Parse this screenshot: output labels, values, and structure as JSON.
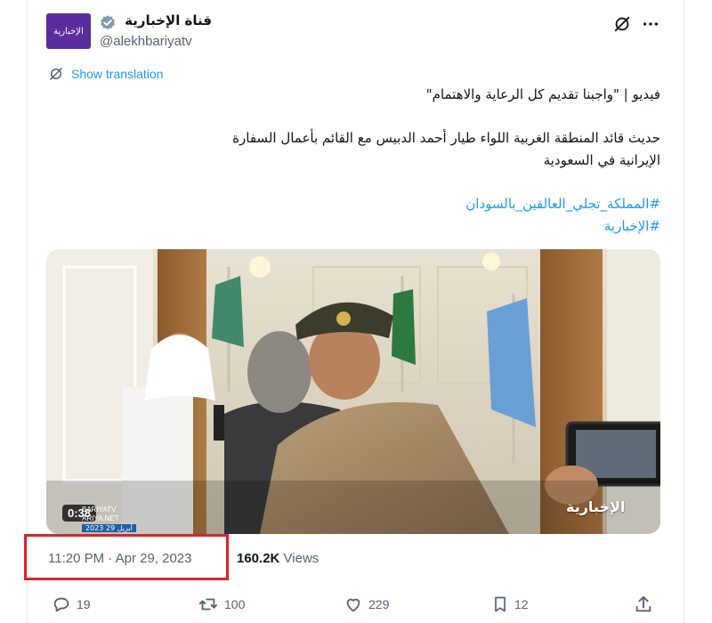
{
  "account": {
    "display_name": "قناة الإخبارية",
    "handle": "@alekhbariyatv",
    "avatar_text": "الإخبارية"
  },
  "translation": {
    "label": "Show translation"
  },
  "tweet": {
    "line1": "فيديو | \"واجبنا تقديم كل الرعاية والاهتمام\"",
    "line2": "حديث قائد المنطقة الغربية اللواء طيار أحمد الدبيس مع القائم بأعمال السفارة",
    "line3": "الإيرانية في السعودية",
    "hashtag1": "#المملكة_تجلي_العالقين_بالسودان",
    "hashtag2": "#الإخبارية"
  },
  "media": {
    "duration": "0:38",
    "watermark": "الإخبارية",
    "watermark_small_1": "BARIYATV",
    "watermark_small_2": "ARIYA.NET",
    "watermark_date": "2023 أبريل 29"
  },
  "meta": {
    "timestamp": "11:20 PM · Apr 29, 2023",
    "views_count": "160.2K",
    "views_label": "Views"
  },
  "actions": {
    "replies": "19",
    "reposts": "100",
    "likes": "229",
    "bookmarks": "12"
  },
  "colors": {
    "accent": "#1d9bf0",
    "highlight_box": "#e5202a",
    "secondary_text": "#536471"
  }
}
